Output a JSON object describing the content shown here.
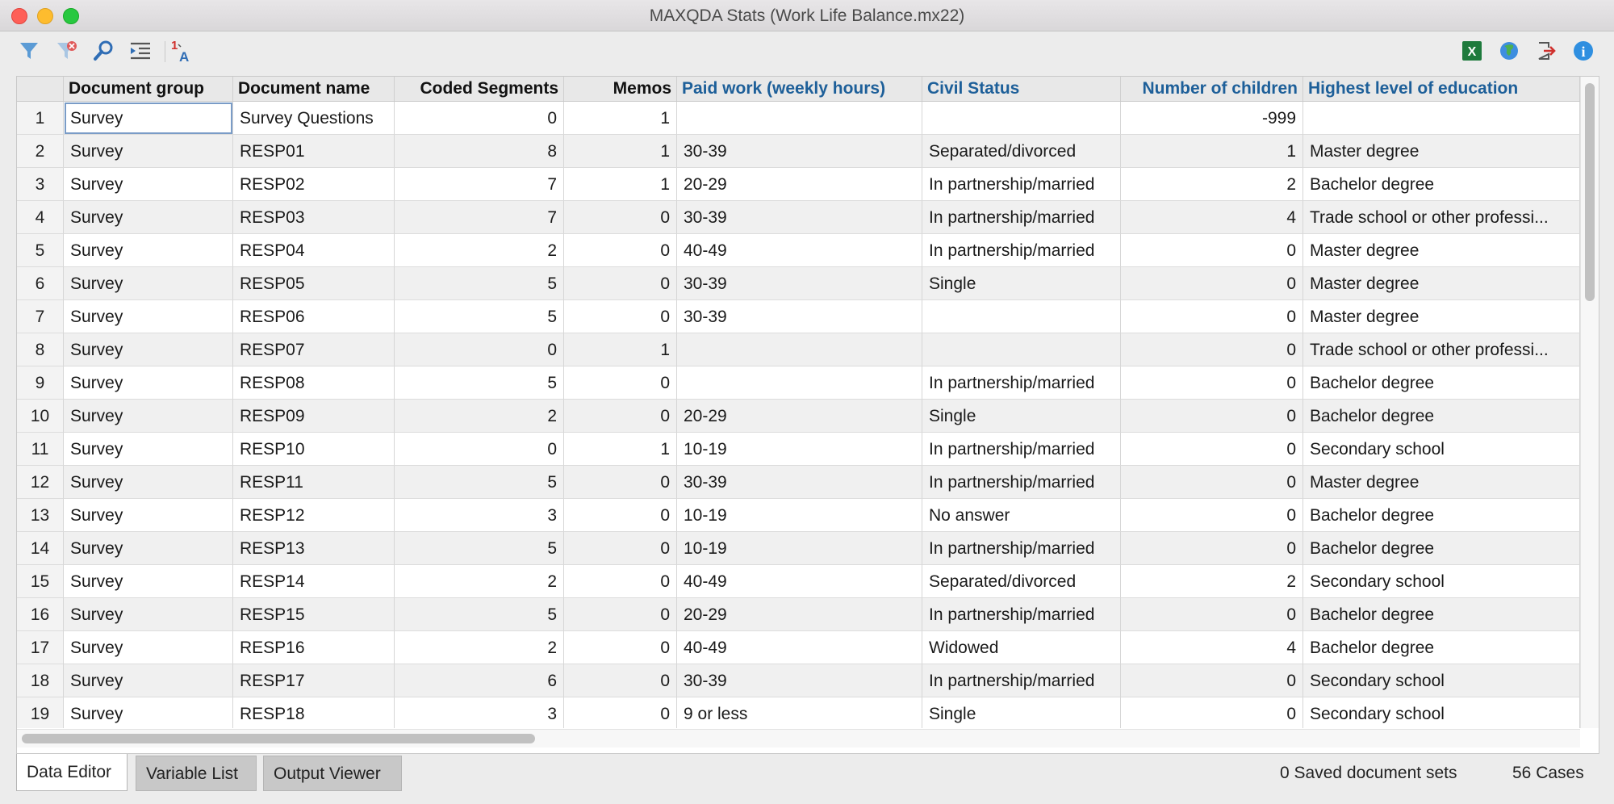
{
  "window": {
    "title": "MAXQDA Stats (Work Life Balance.mx22)"
  },
  "toolbar": {
    "left_icons": [
      "filter-icon",
      "clear-filter-icon",
      "search-icon",
      "indent-list-icon",
      "value-labels-icon"
    ],
    "right_icons": [
      "excel-export-icon",
      "web-export-icon",
      "exit-icon",
      "info-icon"
    ],
    "value_label_glyph_top": "1",
    "value_label_glyph_bottom": "A",
    "excel_glyph": "X",
    "info_glyph": "i"
  },
  "colors": {
    "variable_header": "#1d5f99",
    "excel": "#1e7a3c",
    "info": "#2f8fe0",
    "exit": "#d0312d"
  },
  "table": {
    "columns": [
      {
        "key": "group",
        "label": "Document group",
        "type": "system"
      },
      {
        "key": "name",
        "label": "Document name",
        "type": "system"
      },
      {
        "key": "coded",
        "label": "Coded Segments",
        "type": "system"
      },
      {
        "key": "memos",
        "label": "Memos",
        "type": "system"
      },
      {
        "key": "paid",
        "label": "Paid work (weekly hours)",
        "type": "variable"
      },
      {
        "key": "civil",
        "label": "Civil Status",
        "type": "variable"
      },
      {
        "key": "children",
        "label": "Number of children",
        "type": "variable"
      },
      {
        "key": "edu",
        "label": "Highest level of education",
        "type": "variable"
      }
    ],
    "rows": [
      {
        "n": "1",
        "group": "Survey",
        "name": "Survey Questions",
        "coded": "0",
        "memos": "1",
        "paid": "",
        "civil": "",
        "children": "-999",
        "edu": ""
      },
      {
        "n": "2",
        "group": "Survey",
        "name": "RESP01",
        "coded": "8",
        "memos": "1",
        "paid": "30-39",
        "civil": "Separated/divorced",
        "children": "1",
        "edu": "Master degree"
      },
      {
        "n": "3",
        "group": "Survey",
        "name": "RESP02",
        "coded": "7",
        "memos": "1",
        "paid": "20-29",
        "civil": "In partnership/married",
        "children": "2",
        "edu": "Bachelor degree"
      },
      {
        "n": "4",
        "group": "Survey",
        "name": "RESP03",
        "coded": "7",
        "memos": "0",
        "paid": "30-39",
        "civil": "In partnership/married",
        "children": "4",
        "edu": "Trade school or other professi..."
      },
      {
        "n": "5",
        "group": "Survey",
        "name": "RESP04",
        "coded": "2",
        "memos": "0",
        "paid": "40-49",
        "civil": "In partnership/married",
        "children": "0",
        "edu": "Master degree"
      },
      {
        "n": "6",
        "group": "Survey",
        "name": "RESP05",
        "coded": "5",
        "memos": "0",
        "paid": "30-39",
        "civil": "Single",
        "children": "0",
        "edu": "Master degree"
      },
      {
        "n": "7",
        "group": "Survey",
        "name": "RESP06",
        "coded": "5",
        "memos": "0",
        "paid": "30-39",
        "civil": "",
        "children": "0",
        "edu": "Master degree"
      },
      {
        "n": "8",
        "group": "Survey",
        "name": "RESP07",
        "coded": "0",
        "memos": "1",
        "paid": "",
        "civil": "",
        "children": "0",
        "edu": "Trade school or other professi..."
      },
      {
        "n": "9",
        "group": "Survey",
        "name": "RESP08",
        "coded": "5",
        "memos": "0",
        "paid": "",
        "civil": "In partnership/married",
        "children": "0",
        "edu": "Bachelor degree"
      },
      {
        "n": "10",
        "group": "Survey",
        "name": "RESP09",
        "coded": "2",
        "memos": "0",
        "paid": "20-29",
        "civil": "Single",
        "children": "0",
        "edu": "Bachelor degree"
      },
      {
        "n": "11",
        "group": "Survey",
        "name": "RESP10",
        "coded": "0",
        "memos": "1",
        "paid": "10-19",
        "civil": "In partnership/married",
        "children": "0",
        "edu": "Secondary school"
      },
      {
        "n": "12",
        "group": "Survey",
        "name": "RESP11",
        "coded": "5",
        "memos": "0",
        "paid": "30-39",
        "civil": "In partnership/married",
        "children": "0",
        "edu": "Master degree"
      },
      {
        "n": "13",
        "group": "Survey",
        "name": "RESP12",
        "coded": "3",
        "memos": "0",
        "paid": "10-19",
        "civil": "No answer",
        "children": "0",
        "edu": "Bachelor degree"
      },
      {
        "n": "14",
        "group": "Survey",
        "name": "RESP13",
        "coded": "5",
        "memos": "0",
        "paid": "10-19",
        "civil": "In partnership/married",
        "children": "0",
        "edu": "Bachelor degree"
      },
      {
        "n": "15",
        "group": "Survey",
        "name": "RESP14",
        "coded": "2",
        "memos": "0",
        "paid": "40-49",
        "civil": "Separated/divorced",
        "children": "2",
        "edu": "Secondary school"
      },
      {
        "n": "16",
        "group": "Survey",
        "name": "RESP15",
        "coded": "5",
        "memos": "0",
        "paid": "20-29",
        "civil": "In partnership/married",
        "children": "0",
        "edu": "Bachelor degree"
      },
      {
        "n": "17",
        "group": "Survey",
        "name": "RESP16",
        "coded": "2",
        "memos": "0",
        "paid": "40-49",
        "civil": "Widowed",
        "children": "4",
        "edu": "Bachelor degree"
      },
      {
        "n": "18",
        "group": "Survey",
        "name": "RESP17",
        "coded": "6",
        "memos": "0",
        "paid": "30-39",
        "civil": "In partnership/married",
        "children": "0",
        "edu": "Secondary school"
      },
      {
        "n": "19",
        "group": "Survey",
        "name": "RESP18",
        "coded": "3",
        "memos": "0",
        "paid": "9 or less",
        "civil": "Single",
        "children": "0",
        "edu": "Secondary school"
      }
    ]
  },
  "tabs": [
    {
      "label": "Data Editor",
      "active": true
    },
    {
      "label": "Variable List",
      "active": false
    },
    {
      "label": "Output Viewer",
      "active": false
    }
  ],
  "status": {
    "saved_sets": "0 Saved document sets",
    "cases": "56 Cases"
  }
}
